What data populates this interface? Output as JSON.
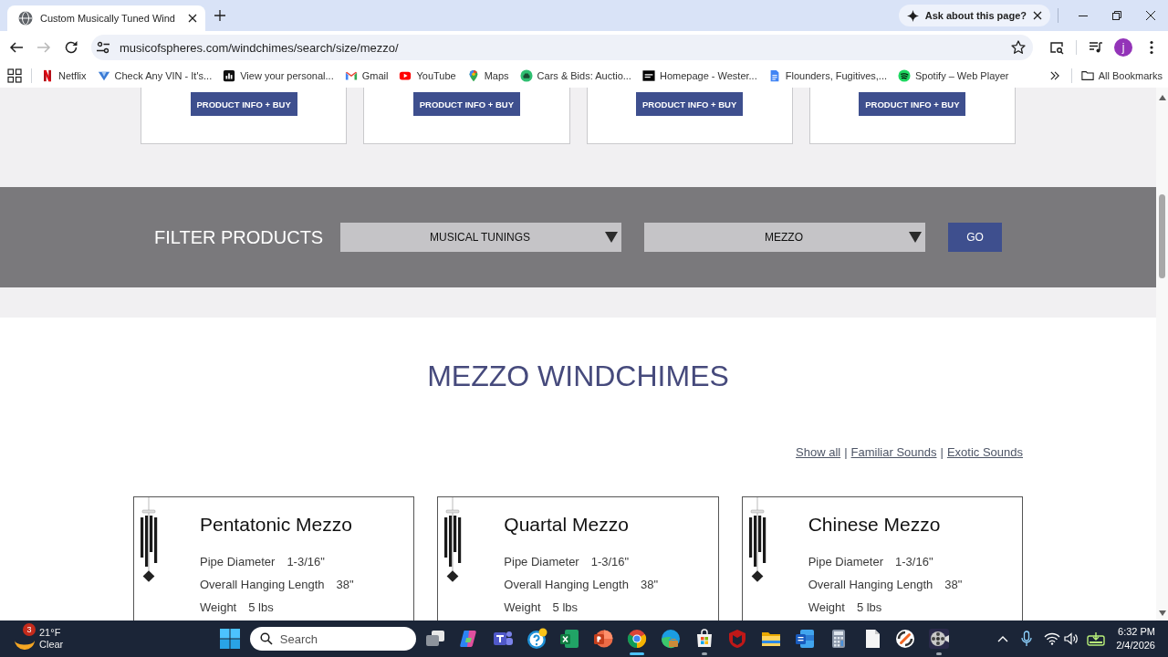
{
  "browser": {
    "tabs": [
      {
        "title": "Custom Musically Tuned Wind",
        "selected": true
      }
    ],
    "ask_chip": {
      "label": "Ask about this page?"
    },
    "nav": {
      "back_disabled": false,
      "forward_disabled": true
    },
    "url": "musicofspheres.com/windchimes/search/size/mezzo/",
    "profile_initial": "j",
    "bookmarks": [
      {
        "kind": "netflix",
        "label": "Netflix"
      },
      {
        "kind": "vin",
        "label": "Check Any VIN - It's..."
      },
      {
        "kind": "chart",
        "label": "View your personal..."
      },
      {
        "kind": "mail",
        "label": "Gmail"
      },
      {
        "kind": "video",
        "label": "YouTube"
      },
      {
        "kind": "maps",
        "label": "Maps"
      },
      {
        "kind": "car",
        "label": "Cars & Bids: Auctio..."
      },
      {
        "kind": "tile",
        "label": "Homepage - Wester..."
      },
      {
        "kind": "docs",
        "label": "Flounders, Fugitives,..."
      },
      {
        "kind": "music",
        "label": "Spotify – Web Player"
      }
    ],
    "all_bookmarks": "All Bookmarks"
  },
  "page": {
    "top_cards": [
      {
        "button": "PRODUCT INFO + BUY"
      },
      {
        "button": "PRODUCT INFO + BUY"
      },
      {
        "button": "PRODUCT INFO + BUY"
      },
      {
        "button": "PRODUCT INFO + BUY"
      }
    ],
    "filter": {
      "title": "FILTER PRODUCTS",
      "selects": [
        {
          "value": "MUSICAL TUNINGS"
        },
        {
          "value": "MEZZO"
        }
      ],
      "button": "GO"
    },
    "heading": "MEZZO WINDCHIMES",
    "links": [
      {
        "kind": "link",
        "text": "Show all"
      },
      {
        "kind": "separator",
        "text": "|"
      },
      {
        "kind": "link",
        "text": "Familiar Sounds"
      },
      {
        "kind": "separator",
        "text": "|"
      },
      {
        "kind": "link",
        "text": "Exotic Sounds"
      }
    ],
    "products": [
      {
        "name": "Pentatonic Mezzo",
        "specs": [
          {
            "label": "Pipe Diameter",
            "value": "1-3/16\""
          },
          {
            "label": "Overall Hanging Length",
            "value": "38\""
          },
          {
            "label": "Weight",
            "value": "5 lbs"
          }
        ]
      },
      {
        "name": "Quartal Mezzo",
        "specs": [
          {
            "label": "Pipe Diameter",
            "value": "1-3/16\""
          },
          {
            "label": "Overall Hanging Length",
            "value": "38\""
          },
          {
            "label": "Weight",
            "value": "5 lbs"
          }
        ]
      },
      {
        "name": "Chinese Mezzo",
        "specs": [
          {
            "label": "Pipe Diameter",
            "value": "1-3/16\""
          },
          {
            "label": "Overall Hanging Length",
            "value": "38\""
          },
          {
            "label": "Weight",
            "value": "5 lbs"
          }
        ]
      }
    ]
  },
  "taskbar": {
    "weather": {
      "badge": "3",
      "temperature": "21°F",
      "condition": "Clear"
    },
    "search": {
      "placeholder": "Search"
    },
    "apps": [
      {
        "kind": "taskview",
        "open": false,
        "active": false
      },
      {
        "kind": "ribbon",
        "open": false,
        "active": false
      },
      {
        "kind": "chat",
        "open": false,
        "active": false
      },
      {
        "kind": "help",
        "open": false,
        "active": false
      },
      {
        "kind": "sheets",
        "open": false,
        "active": false
      },
      {
        "kind": "slides",
        "open": false,
        "active": false
      },
      {
        "kind": "chrome",
        "open": true,
        "active": true
      },
      {
        "kind": "edge",
        "open": false,
        "active": false
      },
      {
        "kind": "store",
        "open": true,
        "active": false
      },
      {
        "kind": "shield",
        "open": false,
        "active": false
      },
      {
        "kind": "folder",
        "open": false,
        "active": false
      },
      {
        "kind": "word",
        "open": false,
        "active": false
      },
      {
        "kind": "calculator",
        "open": false,
        "active": false
      },
      {
        "kind": "notepad",
        "open": false,
        "active": false
      },
      {
        "kind": "orange",
        "open": false,
        "active": false
      },
      {
        "kind": "reel",
        "open": true,
        "active": false
      }
    ],
    "clock": {
      "time": "6:32 PM",
      "date": "2/4/2026"
    }
  }
}
